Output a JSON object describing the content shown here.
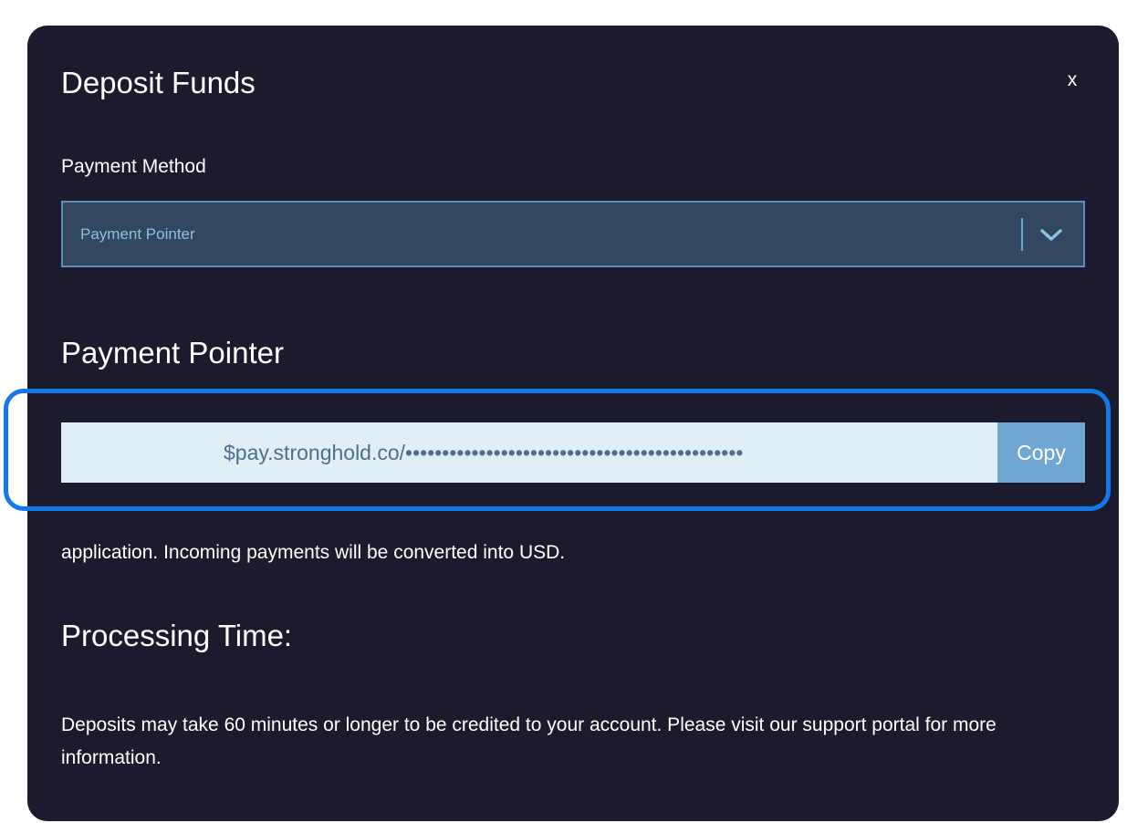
{
  "modal": {
    "title": "Deposit Funds",
    "close_label": "x"
  },
  "payment_method": {
    "label": "Payment Method",
    "selected": "Payment Pointer",
    "chevron_icon": "chevron-down-icon"
  },
  "payment_pointer": {
    "heading": "Payment Pointer",
    "value": "$pay.stronghold.co/••••••••••••••••••••••••••••••••••••••••••••••",
    "copy_label": "Copy",
    "info_text": "application. Incoming payments will be converted into USD."
  },
  "processing": {
    "heading": "Processing Time:",
    "text": "Deposits may take 60 minutes or longer to be credited to your account. Please visit our support portal for more information."
  },
  "colors": {
    "modal_background": "#1b1b2d",
    "select_background": "#344761",
    "select_border": "#5b8fb5",
    "pointer_field_background": "#dfeef7",
    "copy_button": "#6fa6d2",
    "highlight_frame": "#1577ec"
  }
}
